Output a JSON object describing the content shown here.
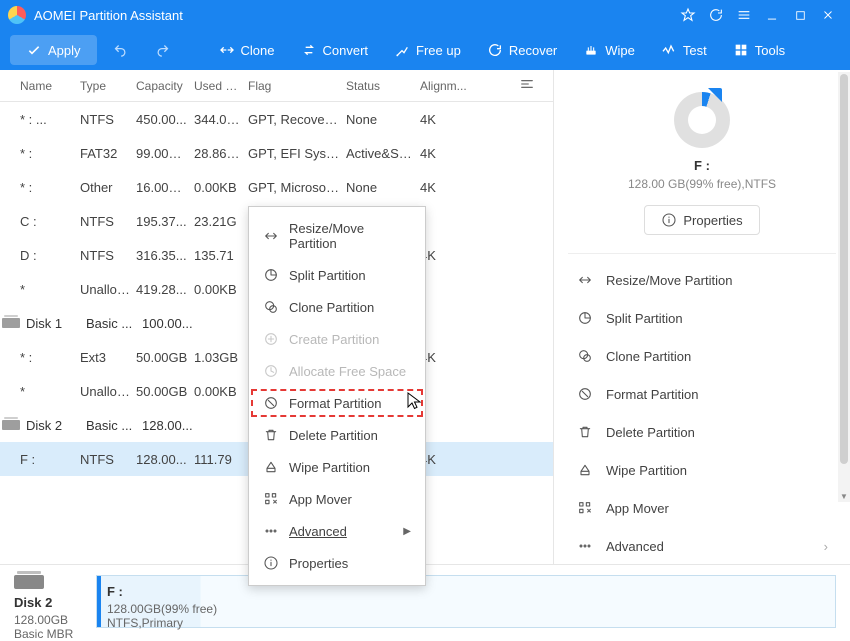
{
  "app": {
    "title": "AOMEI Partition Assistant"
  },
  "toolbar": {
    "apply": "Apply",
    "clone": "Clone",
    "convert": "Convert",
    "freeup": "Free up",
    "recover": "Recover",
    "wipe": "Wipe",
    "test": "Test",
    "tools": "Tools"
  },
  "columns": {
    "name": "Name",
    "type": "Type",
    "capacity": "Capacity",
    "used": "Used S...",
    "flag": "Flag",
    "status": "Status",
    "alignment": "Alignm..."
  },
  "rows": [
    {
      "kind": "part",
      "name": "* : ...",
      "type": "NTFS",
      "cap": "450.00...",
      "used": "344.02...",
      "flag": "GPT, Recovery ...",
      "status": "None",
      "align": "4K"
    },
    {
      "kind": "part",
      "name": "* :",
      "type": "FAT32",
      "cap": "99.00MB",
      "used": "28.86MB",
      "flag": "GPT, EFI Syste...",
      "status": "Active&Syst...",
      "align": "4K"
    },
    {
      "kind": "part",
      "name": "* :",
      "type": "Other",
      "cap": "16.00MB",
      "used": "0.00KB",
      "flag": "GPT, Microsoft ...",
      "status": "None",
      "align": "4K"
    },
    {
      "kind": "part",
      "name": "C :",
      "type": "NTFS",
      "cap": "195.37...",
      "used": "23.21G",
      "flag": "",
      "status": "",
      "align": ""
    },
    {
      "kind": "part",
      "name": "D :",
      "type": "NTFS",
      "cap": "316.35...",
      "used": "135.71",
      "flag": "",
      "status": "",
      "align": "4K"
    },
    {
      "kind": "part",
      "name": "*",
      "type": "Unalloc...",
      "cap": "419.28...",
      "used": "0.00KB",
      "flag": "",
      "status": "",
      "align": ""
    },
    {
      "kind": "disk",
      "name": "Disk 1",
      "type": "Basic ...",
      "cap": "100.00...",
      "used": "",
      "flag": "",
      "status": "",
      "align": ""
    },
    {
      "kind": "part",
      "name": "* :",
      "type": "Ext3",
      "cap": "50.00GB",
      "used": "1.03GB",
      "flag": "",
      "status": "",
      "align": "4K"
    },
    {
      "kind": "part",
      "name": "*",
      "type": "Unalloc...",
      "cap": "50.00GB",
      "used": "0.00KB",
      "flag": "",
      "status": "",
      "align": ""
    },
    {
      "kind": "disk",
      "name": "Disk 2",
      "type": "Basic ...",
      "cap": "128.00...",
      "used": "",
      "flag": "",
      "status": "",
      "align": ""
    },
    {
      "kind": "part",
      "name": "F :",
      "type": "NTFS",
      "cap": "128.00...",
      "used": "111.79",
      "flag": "",
      "status": "",
      "align": "4K",
      "sel": true
    }
  ],
  "context_menu": {
    "resize": "Resize/Move Partition",
    "split": "Split Partition",
    "clone": "Clone Partition",
    "create": "Create Partition",
    "allocate": "Allocate Free Space",
    "format": "Format Partition",
    "delete": "Delete Partition",
    "wipe": "Wipe Partition",
    "appmover": "App Mover",
    "advanced": "Advanced",
    "properties": "Properties"
  },
  "side": {
    "drive_name": "F :",
    "drive_info": "128.00 GB(99% free),NTFS",
    "properties_btn": "Properties",
    "actions": {
      "resize": "Resize/Move Partition",
      "split": "Split Partition",
      "clone": "Clone Partition",
      "format": "Format Partition",
      "delete": "Delete Partition",
      "wipe": "Wipe Partition",
      "appmover": "App Mover",
      "advanced": "Advanced"
    }
  },
  "bottom": {
    "disk_card": {
      "title": "Disk 2",
      "size": "128.00GB",
      "type": "Basic MBR"
    },
    "part_card": {
      "title": "F :",
      "line1": "128.00GB(99% free)",
      "line2": "NTFS,Primary"
    }
  }
}
